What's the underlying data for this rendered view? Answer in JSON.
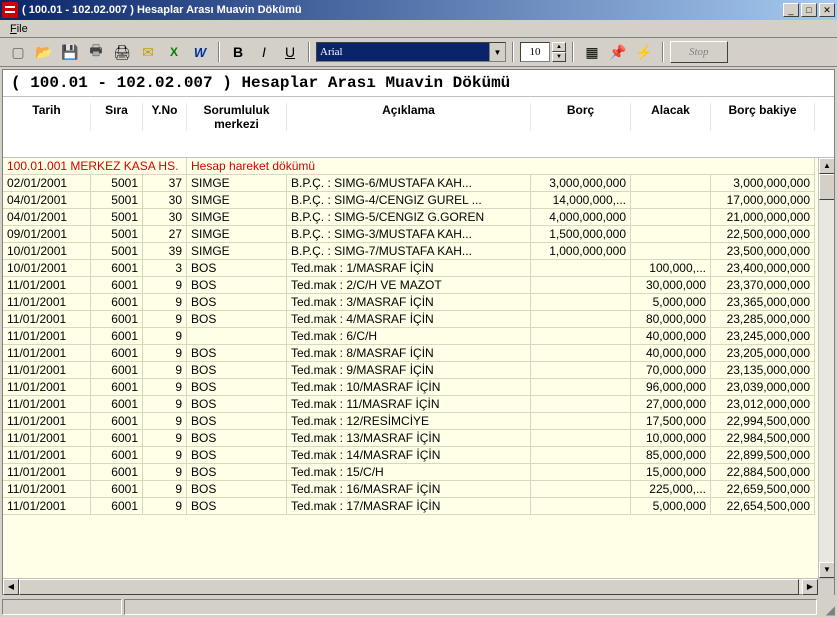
{
  "window": {
    "title": "( 100.01 - 102.02.007 ) Hesaplar Arası Muavin Dökümü"
  },
  "menu": {
    "file": "File"
  },
  "toolbar": {
    "font_name": "Arial",
    "font_size": "10",
    "stop_label": "Stop"
  },
  "report_title": "( 100.01 - 102.02.007 ) Hesaplar Arası Muavin Dökümü",
  "columns": {
    "tarih": "Tarih",
    "sira": "Sıra",
    "yno": "Y.No",
    "sor": "Sorumluluk merkezi",
    "acik": "Açıklama",
    "borc": "Borç",
    "alacak": "Alacak",
    "bbak": "Borç bakiye"
  },
  "section_header": {
    "left": "100.01.001 MERKEZ KASA HS.",
    "right": "Hesap hareket dökümü"
  },
  "rows": [
    {
      "tarih": "02/01/2001",
      "sira": "5001",
      "yno": "37",
      "sor": "SIMGE",
      "acik": "B.P.Ç. : SIMG-6/MUSTAFA KAH...",
      "borc": "3,000,000,000",
      "alacak": "",
      "bbak": "3,000,000,000"
    },
    {
      "tarih": "04/01/2001",
      "sira": "5001",
      "yno": "30",
      "sor": "SIMGE",
      "acik": "B.P.Ç. : SIMG-4/CENGIZ GUREL ...",
      "borc": "14,000,000,...",
      "alacak": "",
      "bbak": "17,000,000,000"
    },
    {
      "tarih": "04/01/2001",
      "sira": "5001",
      "yno": "30",
      "sor": "SIMGE",
      "acik": "B.P.Ç. : SIMG-5/CENGIZ G.GOREN",
      "borc": "4,000,000,000",
      "alacak": "",
      "bbak": "21,000,000,000"
    },
    {
      "tarih": "09/01/2001",
      "sira": "5001",
      "yno": "27",
      "sor": "SIMGE",
      "acik": "B.P.Ç. : SIMG-3/MUSTAFA KAH...",
      "borc": "1,500,000,000",
      "alacak": "",
      "bbak": "22,500,000,000"
    },
    {
      "tarih": "10/01/2001",
      "sira": "5001",
      "yno": "39",
      "sor": "SIMGE",
      "acik": "B.P.Ç. : SIMG-7/MUSTAFA KAH...",
      "borc": "1,000,000,000",
      "alacak": "",
      "bbak": "23,500,000,000"
    },
    {
      "tarih": "10/01/2001",
      "sira": "6001",
      "yno": "3",
      "sor": "BOS",
      "acik": "Ted.mak : 1/MASRAF İÇİN",
      "borc": "",
      "alacak": "100,000,...",
      "bbak": "23,400,000,000"
    },
    {
      "tarih": "11/01/2001",
      "sira": "6001",
      "yno": "9",
      "sor": "BOS",
      "acik": "Ted.mak : 2/C/H VE MAZOT",
      "borc": "",
      "alacak": "30,000,000",
      "bbak": "23,370,000,000"
    },
    {
      "tarih": "11/01/2001",
      "sira": "6001",
      "yno": "9",
      "sor": "BOS",
      "acik": "Ted.mak : 3/MASRAF İÇİN",
      "borc": "",
      "alacak": "5,000,000",
      "bbak": "23,365,000,000"
    },
    {
      "tarih": "11/01/2001",
      "sira": "6001",
      "yno": "9",
      "sor": "BOS",
      "acik": "Ted.mak : 4/MASRAF İÇİN",
      "borc": "",
      "alacak": "80,000,000",
      "bbak": "23,285,000,000"
    },
    {
      "tarih": "11/01/2001",
      "sira": "6001",
      "yno": "9",
      "sor": "",
      "acik": "Ted.mak : 6/C/H",
      "borc": "",
      "alacak": "40,000,000",
      "bbak": "23,245,000,000"
    },
    {
      "tarih": "11/01/2001",
      "sira": "6001",
      "yno": "9",
      "sor": "BOS",
      "acik": "Ted.mak : 8/MASRAF İÇİN",
      "borc": "",
      "alacak": "40,000,000",
      "bbak": "23,205,000,000"
    },
    {
      "tarih": "11/01/2001",
      "sira": "6001",
      "yno": "9",
      "sor": "BOS",
      "acik": "Ted.mak : 9/MASRAF İÇİN",
      "borc": "",
      "alacak": "70,000,000",
      "bbak": "23,135,000,000"
    },
    {
      "tarih": "11/01/2001",
      "sira": "6001",
      "yno": "9",
      "sor": "BOS",
      "acik": "Ted.mak : 10/MASRAF İÇİN",
      "borc": "",
      "alacak": "96,000,000",
      "bbak": "23,039,000,000"
    },
    {
      "tarih": "11/01/2001",
      "sira": "6001",
      "yno": "9",
      "sor": "BOS",
      "acik": "Ted.mak : 11/MASRAF İÇİN",
      "borc": "",
      "alacak": "27,000,000",
      "bbak": "23,012,000,000"
    },
    {
      "tarih": "11/01/2001",
      "sira": "6001",
      "yno": "9",
      "sor": "BOS",
      "acik": "Ted.mak : 12/RESİMCİYE",
      "borc": "",
      "alacak": "17,500,000",
      "bbak": "22,994,500,000"
    },
    {
      "tarih": "11/01/2001",
      "sira": "6001",
      "yno": "9",
      "sor": "BOS",
      "acik": "Ted.mak : 13/MASRAF İÇİN",
      "borc": "",
      "alacak": "10,000,000",
      "bbak": "22,984,500,000"
    },
    {
      "tarih": "11/01/2001",
      "sira": "6001",
      "yno": "9",
      "sor": "BOS",
      "acik": "Ted.mak : 14/MASRAF İÇİN",
      "borc": "",
      "alacak": "85,000,000",
      "bbak": "22,899,500,000"
    },
    {
      "tarih": "11/01/2001",
      "sira": "6001",
      "yno": "9",
      "sor": "BOS",
      "acik": "Ted.mak : 15/C/H",
      "borc": "",
      "alacak": "15,000,000",
      "bbak": "22,884,500,000"
    },
    {
      "tarih": "11/01/2001",
      "sira": "6001",
      "yno": "9",
      "sor": "BOS",
      "acik": "Ted.mak : 16/MASRAF İÇİN",
      "borc": "",
      "alacak": "225,000,...",
      "bbak": "22,659,500,000"
    },
    {
      "tarih": "11/01/2001",
      "sira": "6001",
      "yno": "9",
      "sor": "BOS",
      "acik": "Ted.mak : 17/MASRAF İÇİN",
      "borc": "",
      "alacak": "5,000,000",
      "bbak": "22,654,500,000"
    }
  ]
}
